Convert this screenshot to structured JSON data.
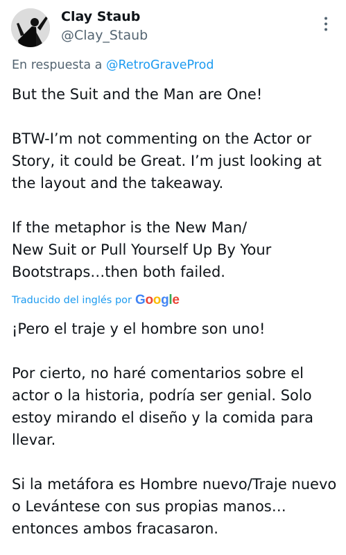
{
  "author": {
    "display_name": "Clay Staub",
    "handle": "@Clay_Staub"
  },
  "reply": {
    "prefix": "En respuesta a ",
    "mention": "@RetroGraveProd"
  },
  "tweet": {
    "original_text": "But the Suit and the Man are One!\n\nBTW-I’m not commenting on the Actor or Story, it could be Great. I’m just looking at the layout and the takeaway.\n\nIf the metaphor is the New Man/\nNew Suit or Pull Yourself Up By Your Bootstraps…then both failed.",
    "translation_label": "Traducido del inglés por",
    "translation_provider": "Google",
    "translated_text": "¡Pero el traje y el hombre son uno!\n\nPor cierto, no haré comentarios sobre el actor o la historia, podría ser genial. Solo estoy mirando el diseño y la comida para llevar.\n\nSi la metáfora es Hombre nuevo/Traje nuevo o Levántese con sus propias manos… entonces ambos fracasaron."
  },
  "colors": {
    "text": "#0f1419",
    "secondary": "#536471",
    "link": "#1d9bf0",
    "google_blue": "#4285f4",
    "google_red": "#ea4335",
    "google_yellow": "#fbbc05",
    "google_green": "#34a853"
  },
  "icons": {
    "more": "more-vertical-icon",
    "logo": "google-logo"
  }
}
